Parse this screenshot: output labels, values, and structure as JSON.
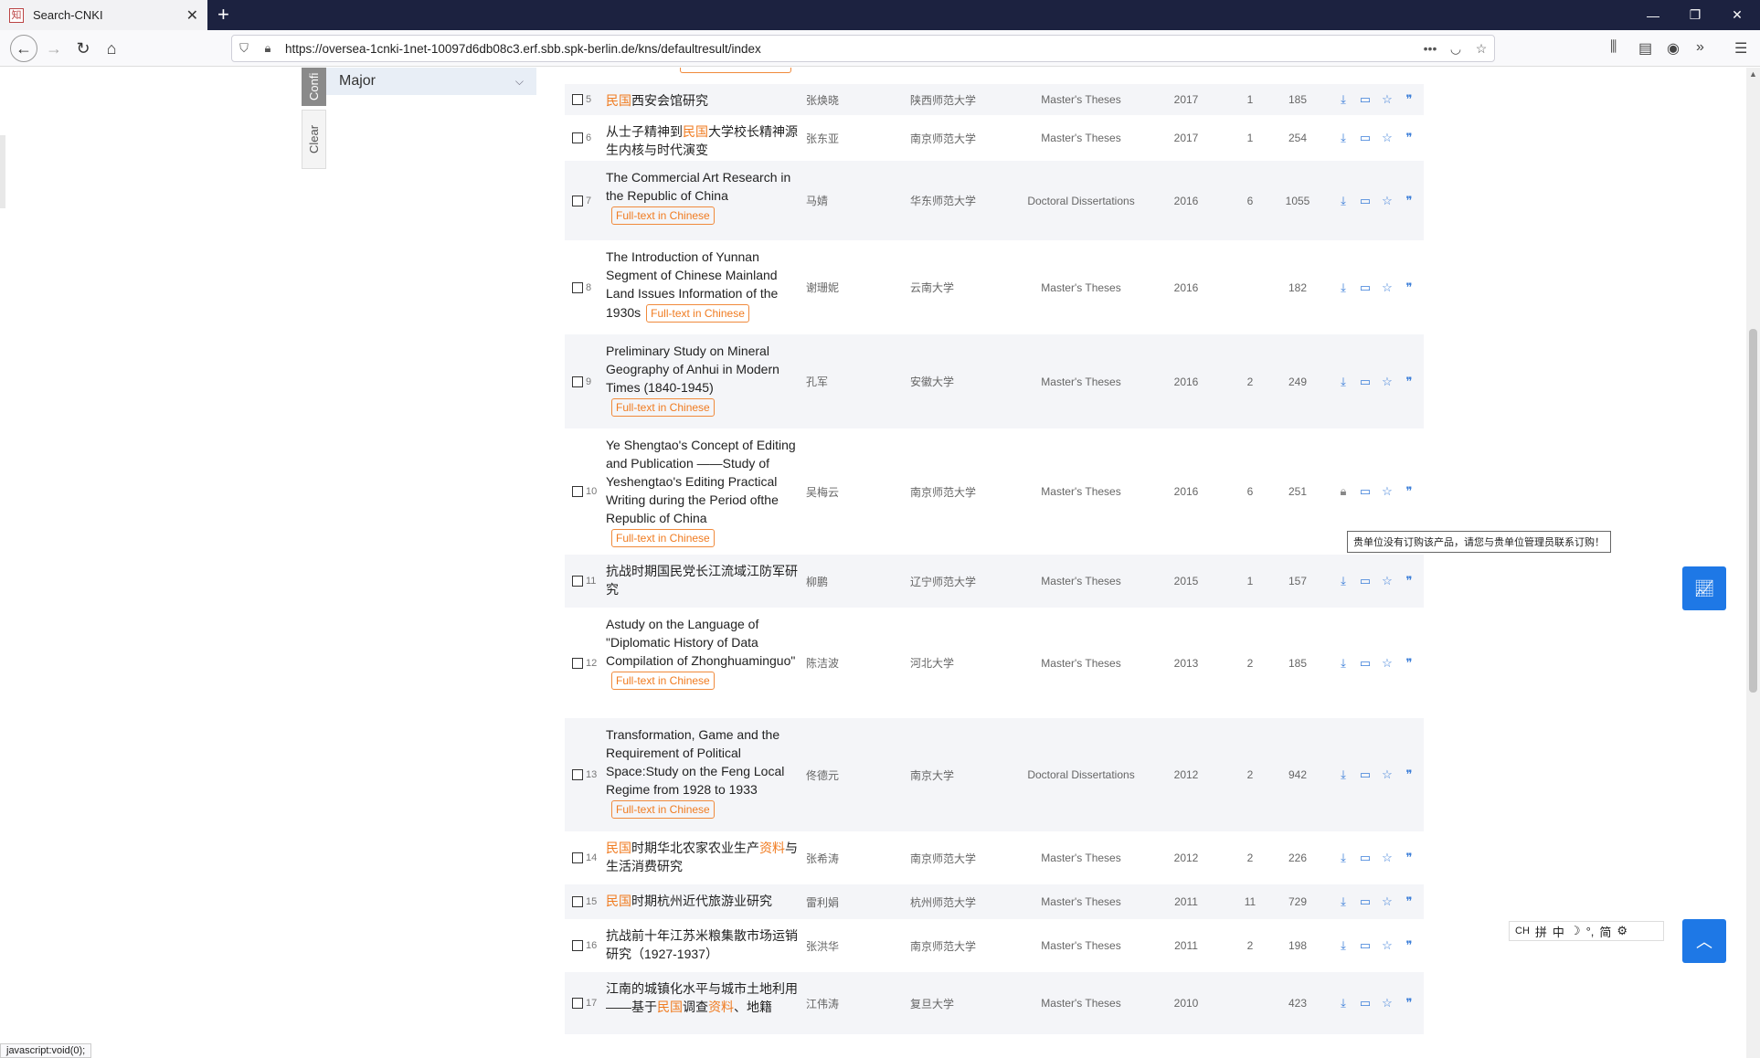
{
  "browser": {
    "tab_title": "Search-CNKI",
    "url": "https://oversea-1cnki-1net-10097d6db08c3.erf.sbb.spk-berlin.de/kns/defaultresult/index",
    "status_text": "javascript:void(0);"
  },
  "sidebar": {
    "active_tab": "Confi",
    "clear_tab": "Clear",
    "major_label": "Major"
  },
  "ft_label": "Full-text in Chinese",
  "tooltip": "贵单位没有订购该产品，请您与贵单位管理员联系订购！",
  "ime": {
    "mode": "CH",
    "items": [
      "拼",
      "中",
      "☽",
      "°,",
      "简",
      "⚙"
    ]
  },
  "rows": [
    {
      "num": "5",
      "title_parts": [
        {
          "t": "民国",
          "hl": true
        },
        {
          "t": "西安会馆研究",
          "hl": false
        }
      ],
      "badge": false,
      "author": "张焕晓",
      "source": "陕西师范大学",
      "type": "Master's Theses",
      "year": "2017",
      "cite": "1",
      "downloads": "185",
      "locked": false
    },
    {
      "num": "6",
      "title_parts": [
        {
          "t": "从士子精神到",
          "hl": false
        },
        {
          "t": "民国",
          "hl": true
        },
        {
          "t": "大学校长精神源生内核与时代演变",
          "hl": false
        }
      ],
      "badge": false,
      "author": "张东亚",
      "source": "南京师范大学",
      "type": "Master's Theses",
      "year": "2017",
      "cite": "1",
      "downloads": "254",
      "locked": false
    },
    {
      "num": "7",
      "title_parts": [
        {
          "t": "The Commercial Art Research in the Republic of China",
          "hl": false
        }
      ],
      "badge": true,
      "author": "马婧",
      "source": "华东师范大学",
      "type": "Doctoral Dissertations",
      "year": "2016",
      "cite": "6",
      "downloads": "1055",
      "locked": false
    },
    {
      "num": "8",
      "title_parts": [
        {
          "t": "The Introduction of Yunnan Segment of Chinese Mainland Land Issues Information of the 1930s",
          "hl": false
        }
      ],
      "badge": true,
      "author": "谢珊妮",
      "source": "云南大学",
      "type": "Master's Theses",
      "year": "2016",
      "cite": "",
      "downloads": "182",
      "locked": false
    },
    {
      "num": "9",
      "title_parts": [
        {
          "t": "Preliminary Study on Mineral Geography of Anhui in Modern Times (1840-1945)",
          "hl": false
        }
      ],
      "badge": true,
      "author": "孔军",
      "source": "安徽大学",
      "type": "Master's Theses",
      "year": "2016",
      "cite": "2",
      "downloads": "249",
      "locked": false
    },
    {
      "num": "10",
      "title_parts": [
        {
          "t": "Ye Shengtao's Concept of Editing and Publication ——Study of Yeshengtao's Editing Practical Writing during the Period ofthe Republic of China",
          "hl": false
        }
      ],
      "badge": true,
      "author": "吴梅云",
      "source": "南京师范大学",
      "type": "Master's Theses",
      "year": "2016",
      "cite": "6",
      "downloads": "251",
      "locked": true
    },
    {
      "num": "11",
      "title_parts": [
        {
          "t": "抗战时期国民党长江流域江防军研究",
          "hl": false
        }
      ],
      "badge": false,
      "author": "柳鹏",
      "source": "辽宁师范大学",
      "type": "Master's Theses",
      "year": "2015",
      "cite": "1",
      "downloads": "157",
      "locked": false
    },
    {
      "num": "12",
      "title_parts": [
        {
          "t": "Astudy on the Language of \"Diplomatic History of Data Compilation of Zhonghuaminguo\"",
          "hl": false
        }
      ],
      "badge": true,
      "author": "陈洁波",
      "source": "河北大学",
      "type": "Master's Theses",
      "year": "2013",
      "cite": "2",
      "downloads": "185",
      "locked": false
    },
    {
      "num": "13",
      "title_parts": [
        {
          "t": "Transformation, Game and the Requirement of Political Space:Study on the Feng Local Regime from 1928 to 1933",
          "hl": false
        }
      ],
      "badge": true,
      "author": "佟德元",
      "source": "南京大学",
      "type": "Doctoral Dissertations",
      "year": "2012",
      "cite": "2",
      "downloads": "942",
      "locked": false
    },
    {
      "num": "14",
      "title_parts": [
        {
          "t": "民国",
          "hl": true
        },
        {
          "t": "时期华北农家农业生产",
          "hl": false
        },
        {
          "t": "资料",
          "hl": true
        },
        {
          "t": "与生活消费研究",
          "hl": false
        }
      ],
      "badge": false,
      "author": "张希涛",
      "source": "南京师范大学",
      "type": "Master's Theses",
      "year": "2012",
      "cite": "2",
      "downloads": "226",
      "locked": false
    },
    {
      "num": "15",
      "title_parts": [
        {
          "t": "民国",
          "hl": true
        },
        {
          "t": "时期杭州近代旅游业研究",
          "hl": false
        }
      ],
      "badge": false,
      "author": "雷利娟",
      "source": "杭州师范大学",
      "type": "Master's Theses",
      "year": "2011",
      "cite": "11",
      "downloads": "729",
      "locked": false
    },
    {
      "num": "16",
      "title_parts": [
        {
          "t": "抗战前十年江苏米粮集散市场运销研究（1927-1937）",
          "hl": false
        }
      ],
      "badge": false,
      "author": "张洪华",
      "source": "南京师范大学",
      "type": "Master's Theses",
      "year": "2011",
      "cite": "2",
      "downloads": "198",
      "locked": false
    },
    {
      "num": "17",
      "title_parts": [
        {
          "t": "江南的城镇化水平与城市土地利用——基于",
          "hl": false
        },
        {
          "t": "民国",
          "hl": true
        },
        {
          "t": "调查",
          "hl": false
        },
        {
          "t": "资料",
          "hl": true
        },
        {
          "t": "、地籍",
          "hl": false
        }
      ],
      "badge": false,
      "author": "江伟涛",
      "source": "复旦大学",
      "type": "Master's Theses",
      "year": "2010",
      "cite": "",
      "downloads": "423",
      "locked": false
    }
  ]
}
